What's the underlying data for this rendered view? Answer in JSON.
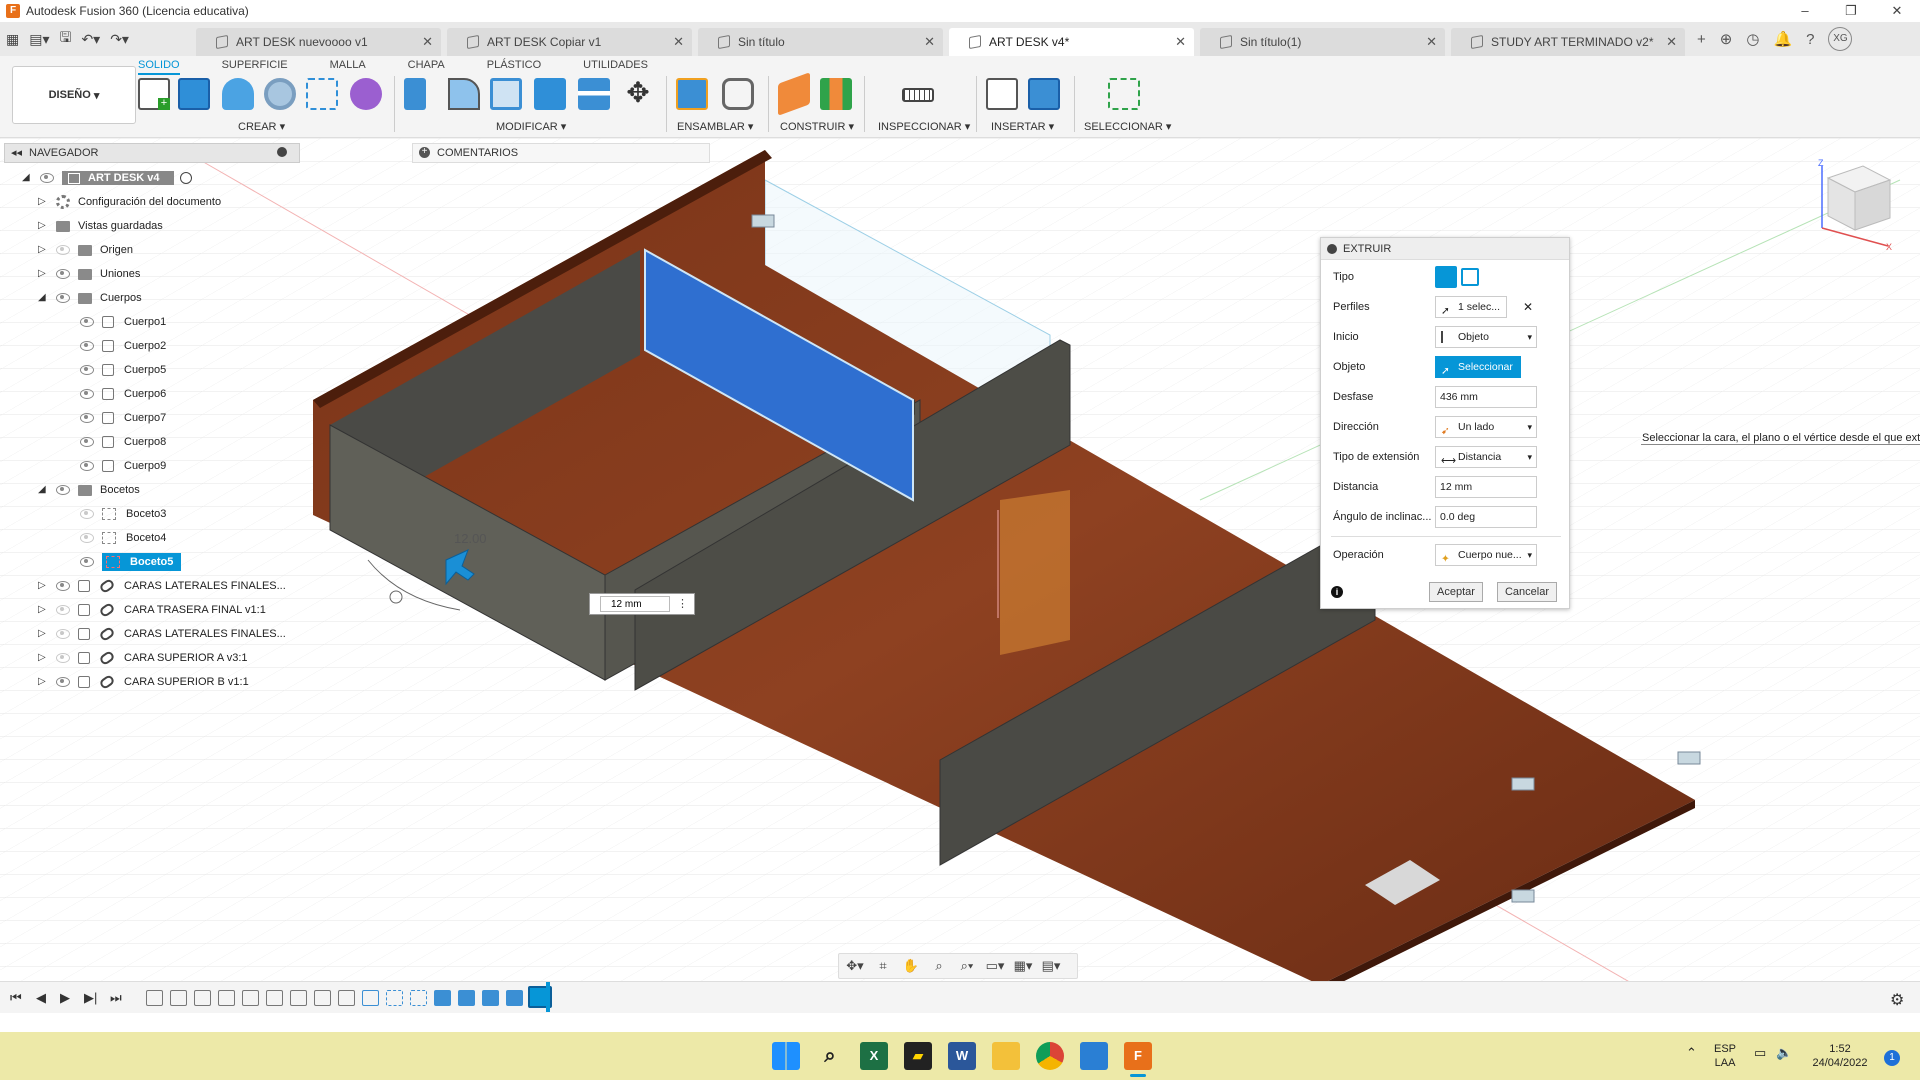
{
  "window": {
    "title": "Autodesk Fusion 360 (Licencia educativa)"
  },
  "tabs": [
    {
      "label": "ART DESK nuevoooo v1",
      "active": false
    },
    {
      "label": "ART DESK Copiar v1",
      "active": false
    },
    {
      "label": "Sin título",
      "active": false
    },
    {
      "label": "ART DESK v4*",
      "active": true
    },
    {
      "label": "Sin título(1)",
      "active": false
    },
    {
      "label": "STUDY ART TERMINADO v2*",
      "active": false
    }
  ],
  "user": {
    "initials": "XG"
  },
  "ribbon": {
    "workspace": "DISEÑO",
    "tabs": [
      "SOLIDO",
      "SUPERFICIE",
      "MALLA",
      "CHAPA",
      "PLÁSTICO",
      "UTILIDADES"
    ],
    "groups": {
      "crear": "CREAR",
      "modificar": "MODIFICAR",
      "ensamblar": "ENSAMBLAR",
      "construir": "CONSTRUIR",
      "inspeccionar": "INSPECCIONAR",
      "insertar": "INSERTAR",
      "seleccionar": "SELECCIONAR"
    },
    "accent": "#0696d7"
  },
  "navigator": {
    "title": "NAVEGADOR",
    "root": "ART DESK v4",
    "items": [
      {
        "label": "Configuración del documento",
        "icon": "gear-icon"
      },
      {
        "label": "Vistas guardadas",
        "icon": "folder-icon"
      },
      {
        "label": "Origen",
        "icon": "folder-icon"
      },
      {
        "label": "Uniones",
        "icon": "folder-icon"
      },
      {
        "label": "Cuerpos",
        "icon": "folder-icon"
      },
      {
        "label": "Cuerpo1"
      },
      {
        "label": "Cuerpo2"
      },
      {
        "label": "Cuerpo5"
      },
      {
        "label": "Cuerpo6"
      },
      {
        "label": "Cuerpo7"
      },
      {
        "label": "Cuerpo8"
      },
      {
        "label": "Cuerpo9"
      },
      {
        "label": "Bocetos",
        "icon": "folder-icon"
      },
      {
        "label": "Boceto3"
      },
      {
        "label": "Boceto4"
      },
      {
        "label": "Boceto5",
        "selected": true
      },
      {
        "label": "CARAS LATERALES FINALES..."
      },
      {
        "label": "CARA TRASERA  FINAL v1:1"
      },
      {
        "label": "CARAS LATERALES FINALES..."
      },
      {
        "label": "CARA SUPERIOR A v3:1"
      },
      {
        "label": "CARA SUPERIOR B v1:1"
      }
    ]
  },
  "comments": {
    "title": "COMENTARIOS"
  },
  "extrude": {
    "title": "EXTRUIR",
    "rows": [
      {
        "label": "Tipo",
        "value": ""
      },
      {
        "label": "Perfiles",
        "value": "1 selec..."
      },
      {
        "label": "Inicio",
        "value": "Objeto"
      },
      {
        "label": "Objeto",
        "value": "Seleccionar"
      },
      {
        "label": "Desfase",
        "value": "436 mm"
      },
      {
        "label": "Dirección",
        "value": "Un lado"
      },
      {
        "label": "Tipo de extensión",
        "value": "Distancia"
      },
      {
        "label": "Distancia",
        "value": "12 mm"
      },
      {
        "label": "Ángulo de inclinac...",
        "value": "0.0 deg"
      },
      {
        "label": "Operación",
        "value": "Cuerpo nue..."
      }
    ],
    "ok": "Aceptar",
    "cancel": "Cancelar"
  },
  "tooltip": "Seleccionar la cara, el plano o el vértice desde el que extr",
  "dimension": {
    "label": "12.00",
    "input": "12 mm"
  },
  "taskbar": {
    "lang": "ESP",
    "layout": "LAA",
    "time": "1:52",
    "date": "24/04/2022",
    "badge": "1"
  }
}
